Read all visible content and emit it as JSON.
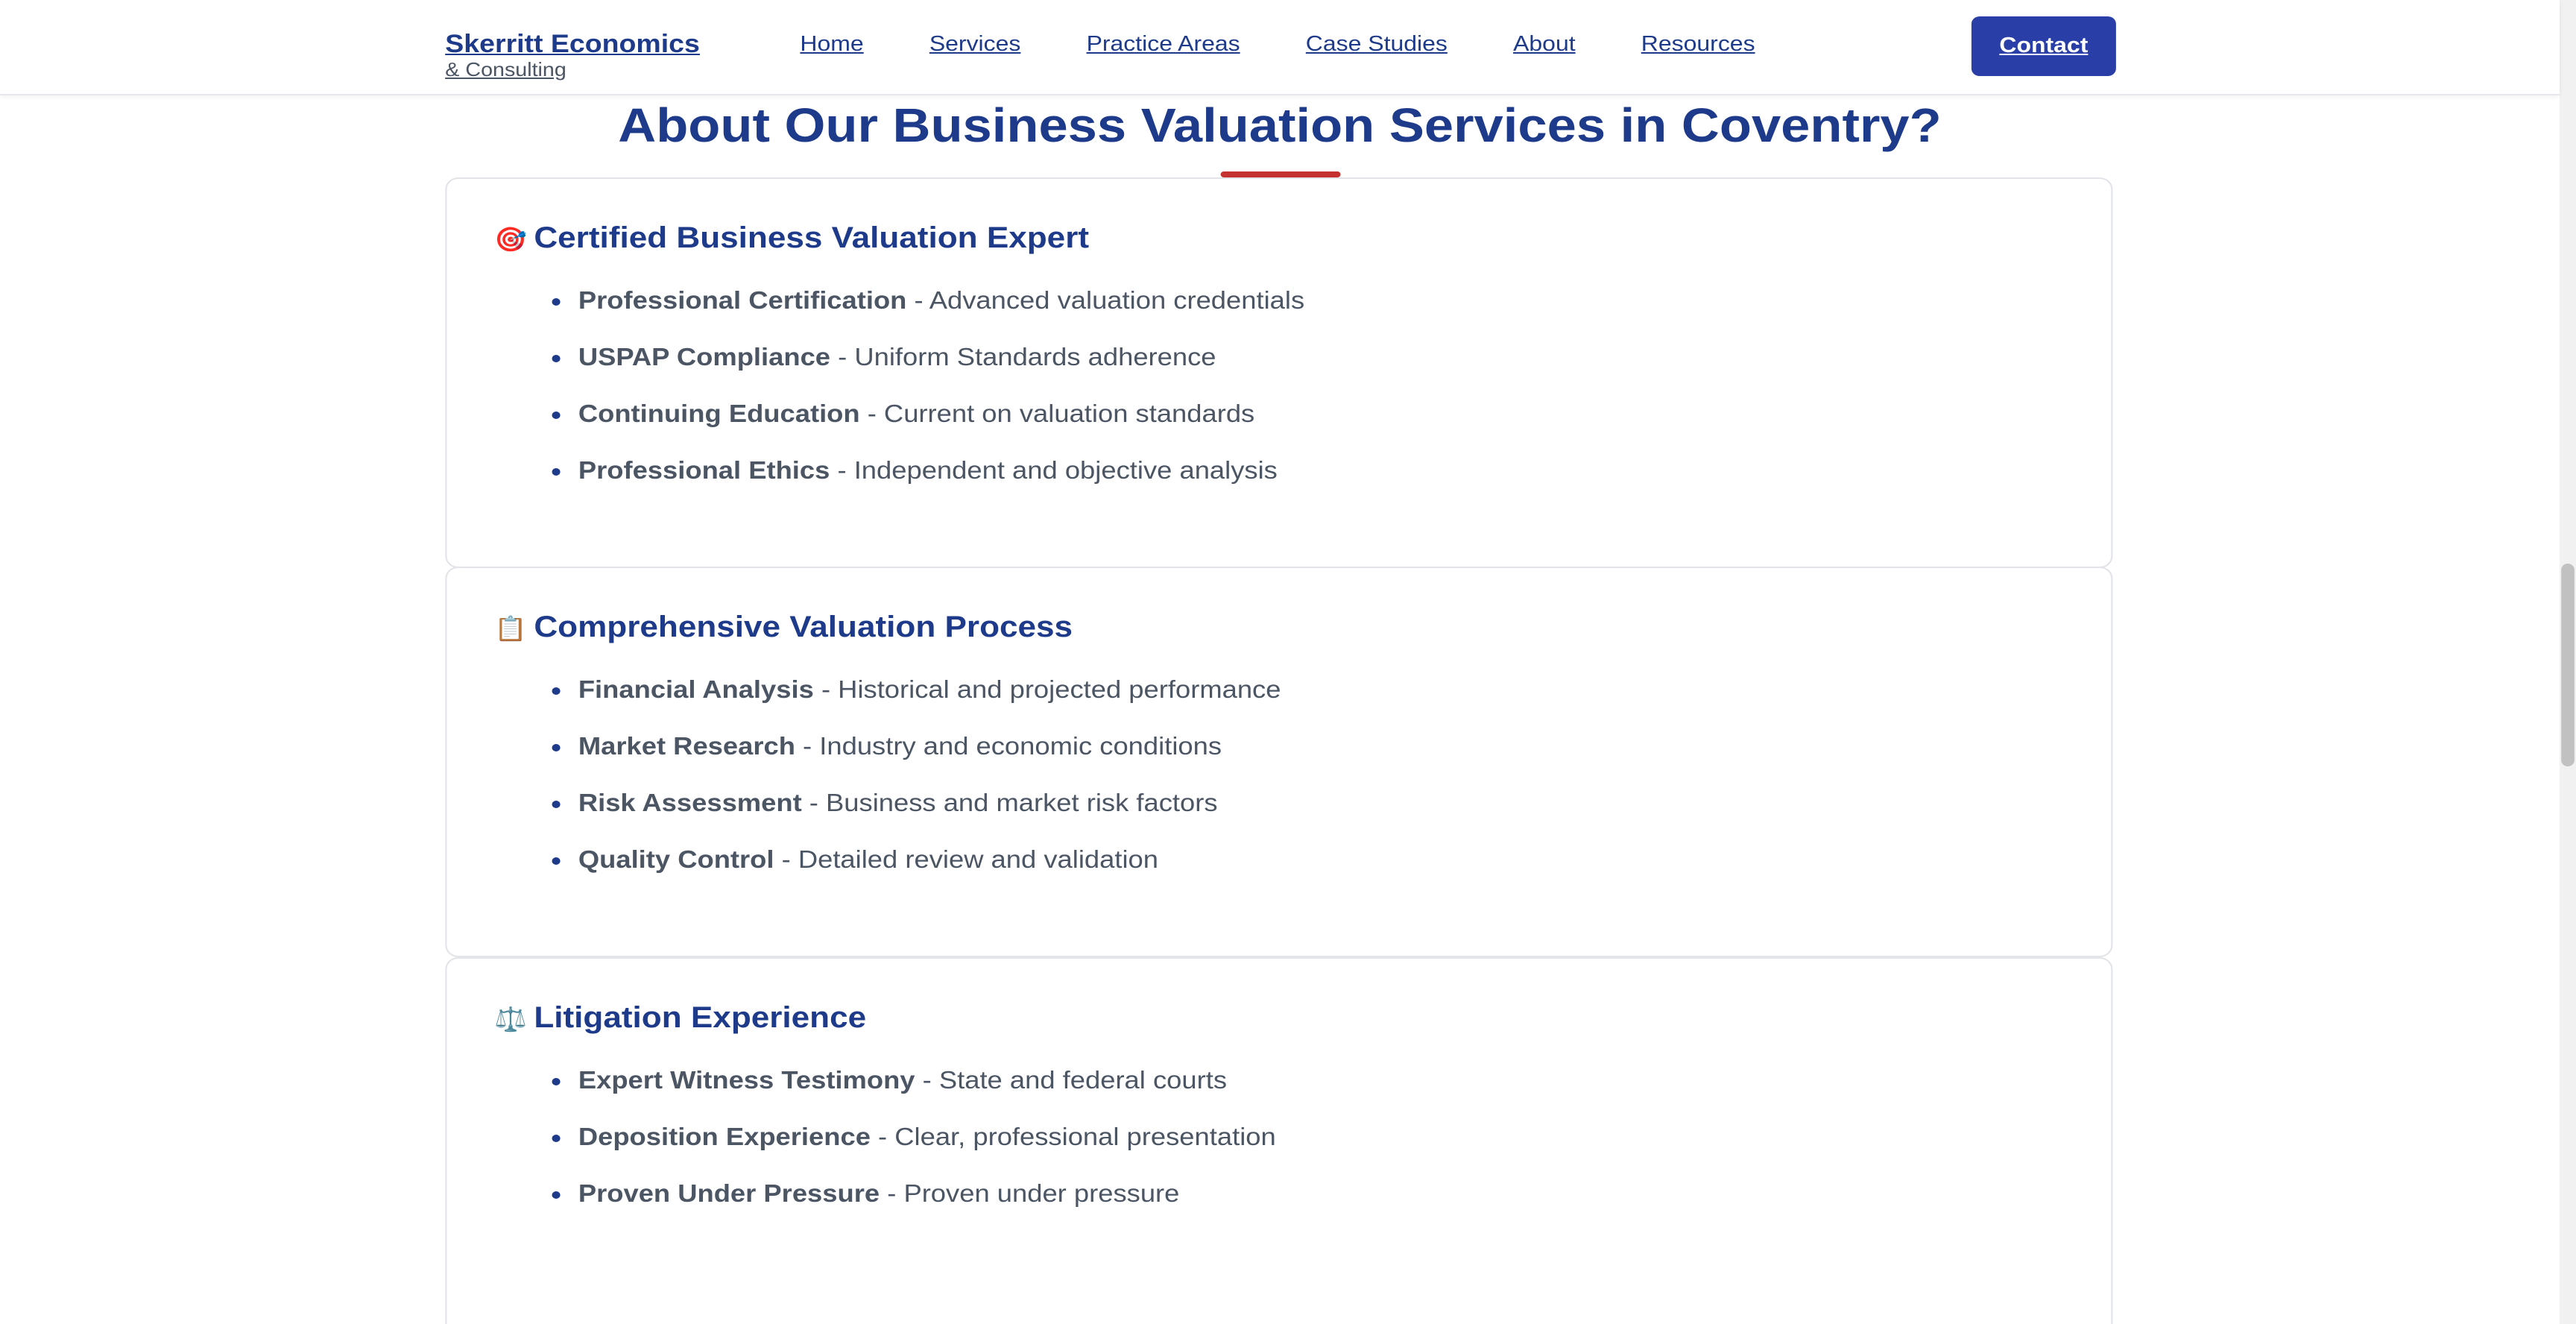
{
  "header": {
    "brand_name": "Skerritt Economics",
    "brand_sub": "& Consulting",
    "nav": [
      "Home",
      "Services",
      "Practice Areas",
      "Case Studies",
      "About",
      "Resources"
    ],
    "contact_label": "Contact"
  },
  "section": {
    "title": "About Our Business Valuation Services in Coventry?"
  },
  "colors": {
    "brand": "#1e3a8a",
    "button": "#2a3ea8",
    "accent_underline": "#c53030",
    "body_text": "#4b5563"
  },
  "cards": [
    {
      "icon": "target-icon",
      "glyph": "🎯",
      "title": "Certified Business Valuation Expert",
      "items": [
        {
          "term": "Professional Certification",
          "desc": " - Advanced valuation credentials"
        },
        {
          "term": "USPAP Compliance",
          "desc": " - Uniform Standards adherence"
        },
        {
          "term": "Continuing Education",
          "desc": " - Current on valuation standards"
        },
        {
          "term": "Professional Ethics",
          "desc": " - Independent and objective analysis"
        }
      ]
    },
    {
      "icon": "clipboard-icon",
      "glyph": "📋",
      "title": "Comprehensive Valuation Process",
      "items": [
        {
          "term": "Financial Analysis",
          "desc": " - Historical and projected performance"
        },
        {
          "term": "Market Research",
          "desc": " - Industry and economic conditions"
        },
        {
          "term": "Risk Assessment",
          "desc": " - Business and market risk factors"
        },
        {
          "term": "Quality Control",
          "desc": " - Detailed review and validation"
        }
      ]
    },
    {
      "icon": "scales-icon",
      "glyph": "⚖️",
      "title": "Litigation Experience",
      "items": [
        {
          "term": "Expert Witness Testimony",
          "desc": " - State and federal courts"
        },
        {
          "term": "Deposition Experience",
          "desc": " - Clear, professional presentation"
        },
        {
          "term": "Proven Under Pressure",
          "desc": " - Proven under pressure"
        }
      ]
    }
  ]
}
